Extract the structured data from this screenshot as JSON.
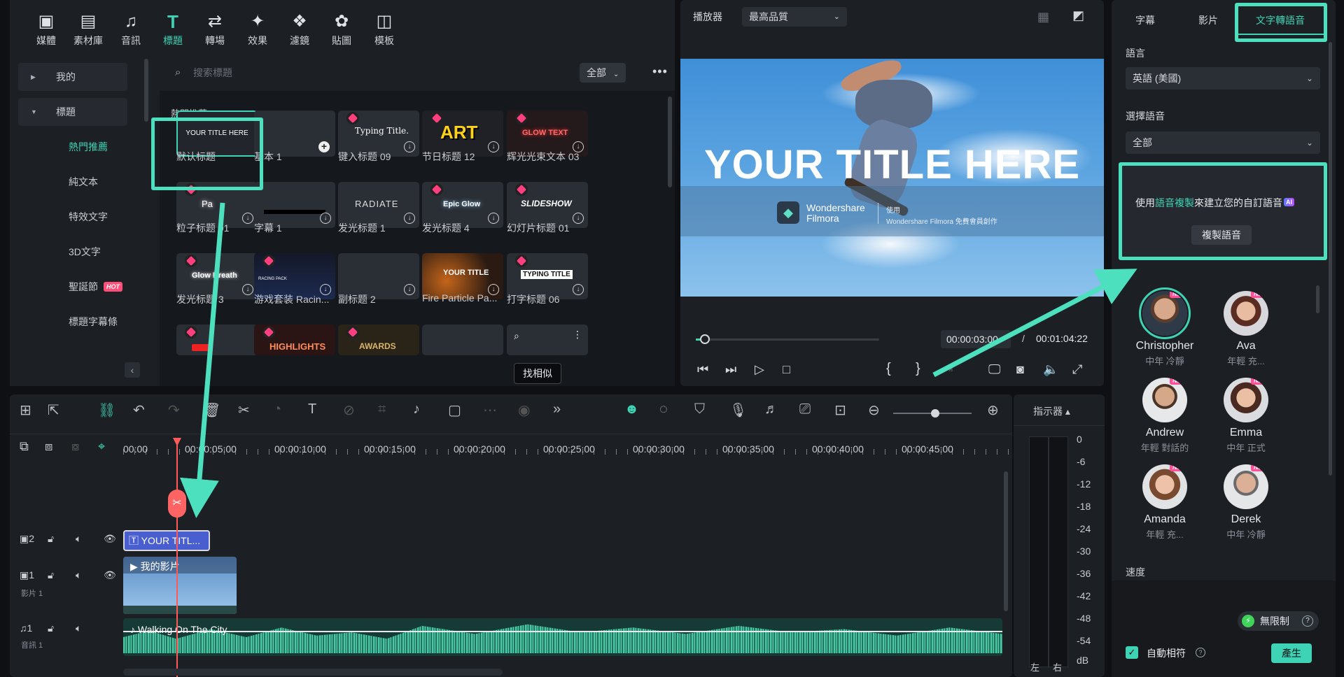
{
  "toolbar": {
    "items": [
      {
        "label": "媒體",
        "icon": "media-icon"
      },
      {
        "label": "素材庫",
        "icon": "stock-icon"
      },
      {
        "label": "音訊",
        "icon": "music-icon"
      },
      {
        "label": "標題",
        "icon": "title-icon",
        "active": true
      },
      {
        "label": "轉場",
        "icon": "transition-icon"
      },
      {
        "label": "效果",
        "icon": "effects-icon"
      },
      {
        "label": "濾鏡",
        "icon": "filter-icon"
      },
      {
        "label": "貼圖",
        "icon": "sticker-icon"
      },
      {
        "label": "模板",
        "icon": "template-icon"
      }
    ]
  },
  "sidebar": {
    "items": [
      {
        "label": "我的",
        "type": "group",
        "collapsed": true
      },
      {
        "label": "標題",
        "type": "group",
        "collapsed": false
      },
      {
        "label": "熱門推薦",
        "type": "sub",
        "selected": true
      },
      {
        "label": "純文本",
        "type": "sub"
      },
      {
        "label": "特效文字",
        "type": "sub"
      },
      {
        "label": "3D文字",
        "type": "sub"
      },
      {
        "label": "聖誕節",
        "type": "sub",
        "badge": "HOT"
      },
      {
        "label": "標題字幕條",
        "type": "sub"
      }
    ]
  },
  "content": {
    "search_placeholder": "搜索標題",
    "filter": "全部",
    "section": "熱門推薦",
    "tooltip": "找相似",
    "items": [
      {
        "label": "默认标题",
        "thumb": "YOUR TITLE HERE"
      },
      {
        "label": "基本 1",
        "thumb": ""
      },
      {
        "label": "键入标题 09",
        "thumb": "Typing Title."
      },
      {
        "label": "节日标题 12",
        "thumb": "ART"
      },
      {
        "label": "辉光光束文本 03",
        "thumb": "GLOW TEXT"
      },
      {
        "label": "粒子标题 01",
        "thumb": "Pa"
      },
      {
        "label": "字幕 1",
        "thumb": ""
      },
      {
        "label": "发光标题 1",
        "thumb": "RADIATE"
      },
      {
        "label": "发光标题 4",
        "thumb": "Epic Glow"
      },
      {
        "label": "幻灯片标题 01",
        "thumb": "SLIDESHOW"
      },
      {
        "label": "发光标题 3",
        "thumb": "Glow Breath"
      },
      {
        "label": "游戏套装 Racin...",
        "thumb": "RACING PACK"
      },
      {
        "label": "副标题 2",
        "thumb": ""
      },
      {
        "label": "Fire Particle Pa...",
        "thumb": "YOUR TITLE"
      },
      {
        "label": "打字标题 06",
        "thumb": "TYPING TITLE"
      },
      {
        "label": "",
        "thumb": ""
      },
      {
        "label": "",
        "thumb": "HIGHLIGHTS"
      },
      {
        "label": "",
        "thumb": "AWARDS"
      },
      {
        "label": "",
        "thumb": ""
      },
      {
        "label": "",
        "thumb": ""
      }
    ]
  },
  "player": {
    "label": "播放器",
    "quality": "最高品質",
    "title_overlay": "YOUR TITLE HERE",
    "watermark_brand": "Wondershare Filmora",
    "watermark_use": "使用",
    "watermark_note": "Wondershare Filmora 免費會員創作",
    "current_time": "00:00:03:00",
    "separator": "/",
    "total_time": "00:01:04:22",
    "progress": 0.05
  },
  "tts": {
    "tabs": [
      "字幕",
      "影片",
      "文字轉語音"
    ],
    "active_tab": "文字轉語音",
    "language_label": "語言",
    "language_value": "英語 (美國)",
    "voice_label": "選擇語音",
    "voice_value": "全部",
    "clone_prefix": "使用",
    "clone_link": "語音複製",
    "clone_suffix": "來建立您的自訂語音",
    "clone_button": "複製語音",
    "ai_badge": "AI",
    "voices": [
      {
        "name": "Christopher",
        "desc": "中年 冷靜",
        "selected": true
      },
      {
        "name": "Ava",
        "desc": "年輕 充..."
      },
      {
        "name": "Andrew",
        "desc": "年輕 對話的"
      },
      {
        "name": "Emma",
        "desc": "中年 正式"
      },
      {
        "name": "Amanda",
        "desc": "年輕 充..."
      },
      {
        "name": "Derek",
        "desc": "中年 冷靜"
      }
    ],
    "new_badge": "NEW",
    "speed_label": "速度",
    "unlimited": "無限制",
    "auto_match": "自動相符",
    "generate": "產生"
  },
  "timeline": {
    "ruler": [
      "00:00",
      "00:00:05:00",
      "00:00:10:00",
      "00:00:15:00",
      "00:00:20:00",
      "00:00:25:00",
      "00:00:30:00",
      "00:00:35:00",
      "00:00:40:00",
      "00:00:45:00"
    ],
    "tracks": {
      "t2": "2",
      "t1": "1",
      "t1_label": "影片 1",
      "a1": "1",
      "a1_label": "音訊 1"
    },
    "title_clip": "YOUR TITL...",
    "video_clip": "我的影片",
    "audio_clip": "Walking On The City"
  },
  "meter": {
    "label": "指示器",
    "db": [
      "0",
      "-6",
      "-12",
      "-18",
      "-24",
      "-30",
      "-36",
      "-42",
      "-48",
      "-54",
      "dB"
    ],
    "left": "左",
    "right": "右"
  },
  "colors": {
    "accent": "#3fd3b5",
    "highlight": "#4de0be",
    "pink": "#ff4e7a",
    "playhead": "#ff5a5a"
  }
}
